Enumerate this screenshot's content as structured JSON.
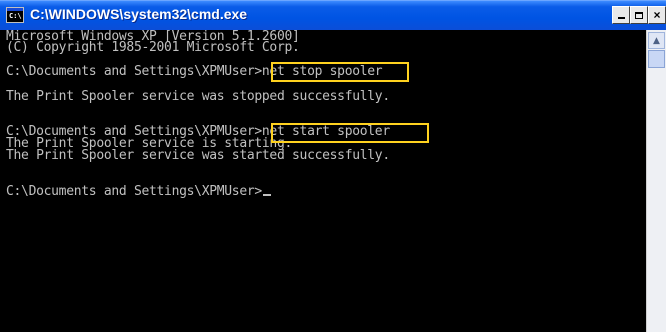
{
  "window": {
    "title": "C:\\WINDOWS\\system32\\cmd.exe",
    "icon_label": "C:\\",
    "controls": {
      "minimize": "minimize-icon",
      "maximize": "maximize-icon",
      "close": "×"
    }
  },
  "console": {
    "lines": [
      "Microsoft Windows XP [Version 5.1.2600]",
      "(C) Copyright 1985-2001 Microsoft Corp.",
      "C:\\Documents and Settings\\XPMUser>net stop spooler",
      "The Print Spooler service was stopped successfully.",
      "C:\\Documents and Settings\\XPMUser>net start spooler",
      "The Print Spooler service is starting.",
      "The Print Spooler service was started successfully.",
      "C:\\Documents and Settings\\XPMUser>"
    ]
  },
  "colors": {
    "titlebar": "#0054e3",
    "console_text": "#c0c0c0",
    "console_bg": "#000000",
    "highlight": "#ffd21f"
  },
  "scrollbar": {
    "up_arrow": "▲"
  }
}
